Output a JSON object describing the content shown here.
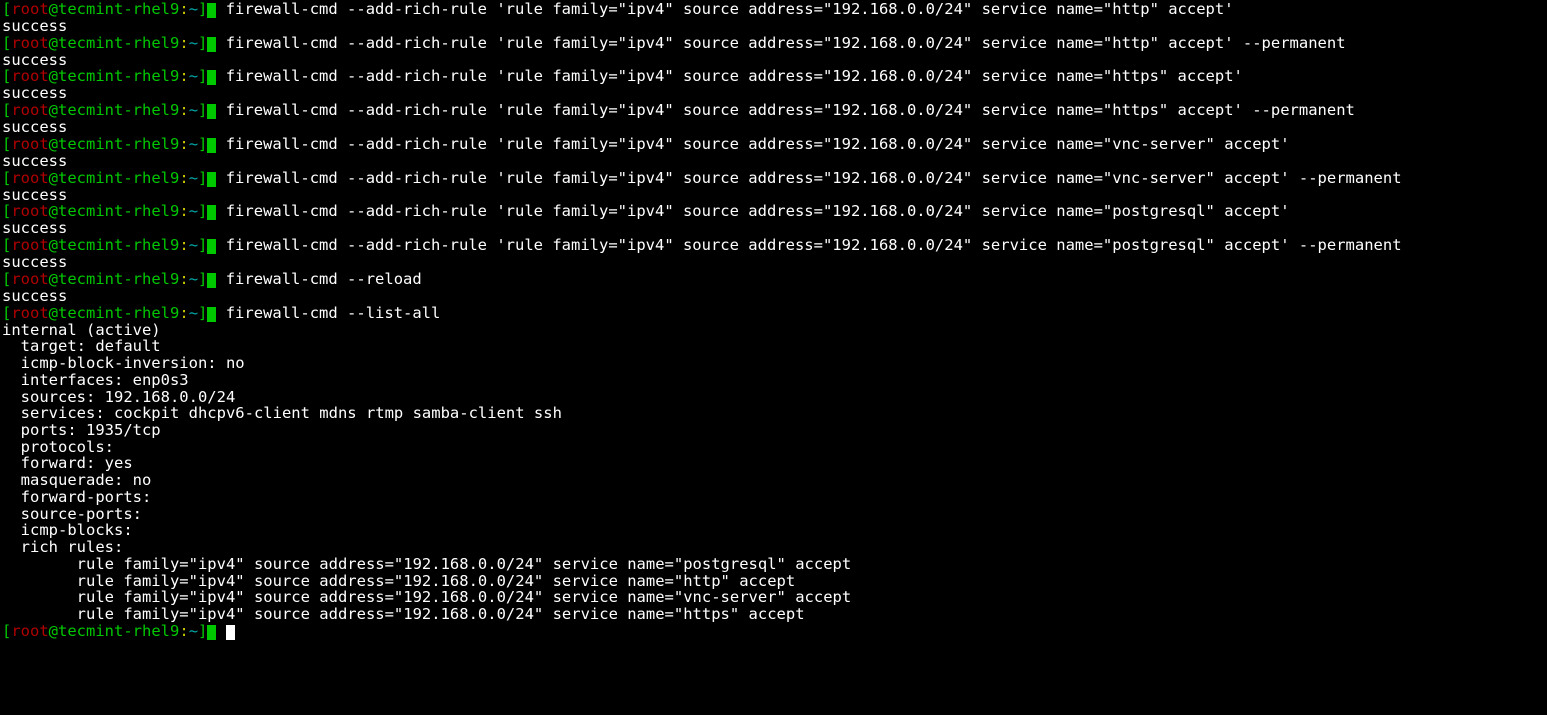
{
  "prompt": {
    "lb": "[",
    "user": "root",
    "at": "@",
    "host": "tecmint-rhel9",
    "sep": ":",
    "cwd": "~",
    "rb": "]",
    "hash": "#"
  },
  "entries": [
    {
      "cmd": "firewall-cmd --add-rich-rule 'rule family=\"ipv4\" source address=\"192.168.0.0/24\" service name=\"http\" accept'",
      "out": [
        "success"
      ]
    },
    {
      "cmd": "firewall-cmd --add-rich-rule 'rule family=\"ipv4\" source address=\"192.168.0.0/24\" service name=\"http\" accept' --permanent",
      "out": [
        "success"
      ]
    },
    {
      "cmd": "firewall-cmd --add-rich-rule 'rule family=\"ipv4\" source address=\"192.168.0.0/24\" service name=\"https\" accept'",
      "out": [
        "success"
      ]
    },
    {
      "cmd": "firewall-cmd --add-rich-rule 'rule family=\"ipv4\" source address=\"192.168.0.0/24\" service name=\"https\" accept' --permanent",
      "out": [
        "success"
      ]
    },
    {
      "cmd": "firewall-cmd --add-rich-rule 'rule family=\"ipv4\" source address=\"192.168.0.0/24\" service name=\"vnc-server\" accept'",
      "out": [
        "success"
      ]
    },
    {
      "cmd": "firewall-cmd --add-rich-rule 'rule family=\"ipv4\" source address=\"192.168.0.0/24\" service name=\"vnc-server\" accept' --permanent",
      "out": [
        "success"
      ]
    },
    {
      "cmd": "firewall-cmd --add-rich-rule 'rule family=\"ipv4\" source address=\"192.168.0.0/24\" service name=\"postgresql\" accept'",
      "out": [
        "success"
      ]
    },
    {
      "cmd": "firewall-cmd --add-rich-rule 'rule family=\"ipv4\" source address=\"192.168.0.0/24\" service name=\"postgresql\" accept' --permanent",
      "out": [
        "success"
      ]
    },
    {
      "cmd": "firewall-cmd --reload",
      "out": [
        "success"
      ]
    },
    {
      "cmd": "firewall-cmd --list-all",
      "out": [
        "internal (active)",
        "  target: default",
        "  icmp-block-inversion: no",
        "  interfaces: enp0s3",
        "  sources: 192.168.0.0/24",
        "  services: cockpit dhcpv6-client mdns rtmp samba-client ssh",
        "  ports: 1935/tcp",
        "  protocols:",
        "  forward: yes",
        "  masquerade: no",
        "  forward-ports:",
        "  source-ports:",
        "  icmp-blocks:",
        "  rich rules:",
        "        rule family=\"ipv4\" source address=\"192.168.0.0/24\" service name=\"postgresql\" accept",
        "        rule family=\"ipv4\" source address=\"192.168.0.0/24\" service name=\"http\" accept",
        "        rule family=\"ipv4\" source address=\"192.168.0.0/24\" service name=\"vnc-server\" accept",
        "        rule family=\"ipv4\" source address=\"192.168.0.0/24\" service name=\"https\" accept"
      ]
    }
  ],
  "trailing_prompt": true
}
